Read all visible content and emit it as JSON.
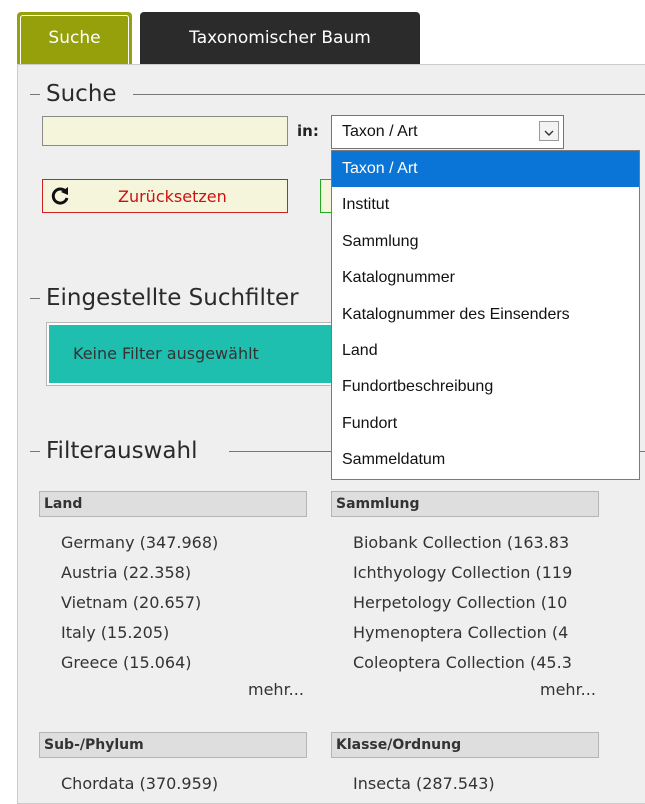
{
  "tabs": [
    {
      "label": "Suche"
    },
    {
      "label": "Taxonomischer Baum"
    }
  ],
  "search": {
    "legend": "Suche",
    "input_value": "",
    "in_label": "in:",
    "selected": "Taxon / Art",
    "options": [
      "Taxon / Art",
      "Institut",
      "Sammlung",
      "Katalognummer",
      "Katalognummer des Einsenders",
      "Land",
      "Fundortbeschreibung",
      "Fundort",
      "Sammeldatum"
    ],
    "reset_label": "Zurücksetzen"
  },
  "filters": {
    "legend": "Eingestellte Suchfilter",
    "empty_label": "Keine Filter ausgewählt"
  },
  "selection": {
    "legend": "Filterauswahl",
    "more_label": "mehr...",
    "groups": [
      {
        "title": "Land",
        "items": [
          "Germany (347.968)",
          "Austria (22.358)",
          "Vietnam (20.657)",
          "Italy (15.205)",
          "Greece (15.064)"
        ]
      },
      {
        "title": "Sammlung",
        "items": [
          "Biobank Collection (163.83",
          "Ichthyology Collection (119",
          "Herpetology Collection (10",
          "Hymenoptera Collection (4",
          "Coleoptera Collection (45.3"
        ]
      },
      {
        "title": "Sub-/Phylum",
        "items": [
          "Chordata (370.959)"
        ]
      },
      {
        "title": "Klasse/Ordnung",
        "items": [
          "Insecta (287.543)"
        ]
      }
    ]
  },
  "colors": {
    "active_tab": "#96a00b",
    "inactive_tab": "#2b2b2b",
    "filter_box": "#1fbfb0",
    "dropdown_highlight": "#0a75d6",
    "reset_text": "#cc1111"
  },
  "icons": {
    "reset": "refresh-icon",
    "select": "chevron-down-icon"
  }
}
